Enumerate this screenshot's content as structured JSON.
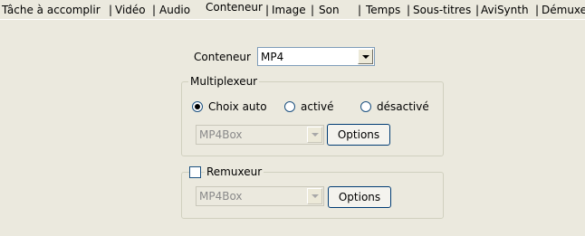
{
  "tabs": [
    {
      "label": "Tâche à accomplir"
    },
    {
      "label": "Vidéo"
    },
    {
      "label": "Audio"
    },
    {
      "label": "Conteneur",
      "active": true
    },
    {
      "label": "Image"
    },
    {
      "label": "Son"
    },
    {
      "label": "Temps"
    },
    {
      "label": "Sous-titres"
    },
    {
      "label": "AviSynth"
    },
    {
      "label": "Démuxe"
    }
  ],
  "container": {
    "label": "Conteneur",
    "value": "MP4"
  },
  "multiplexer": {
    "title": "Multiplexeur",
    "options": {
      "auto": "Choix auto",
      "enabled": "activé",
      "disabled": "désactivé"
    },
    "selected": "auto",
    "tool_value": "MP4Box",
    "options_button": "Options"
  },
  "remuxer": {
    "title": "Remuxeur",
    "checked": false,
    "tool_value": "MP4Box",
    "options_button": "Options"
  },
  "colors": {
    "background": "#ebe9de",
    "field_border": "#7f9db9",
    "button_border": "#003c74"
  }
}
